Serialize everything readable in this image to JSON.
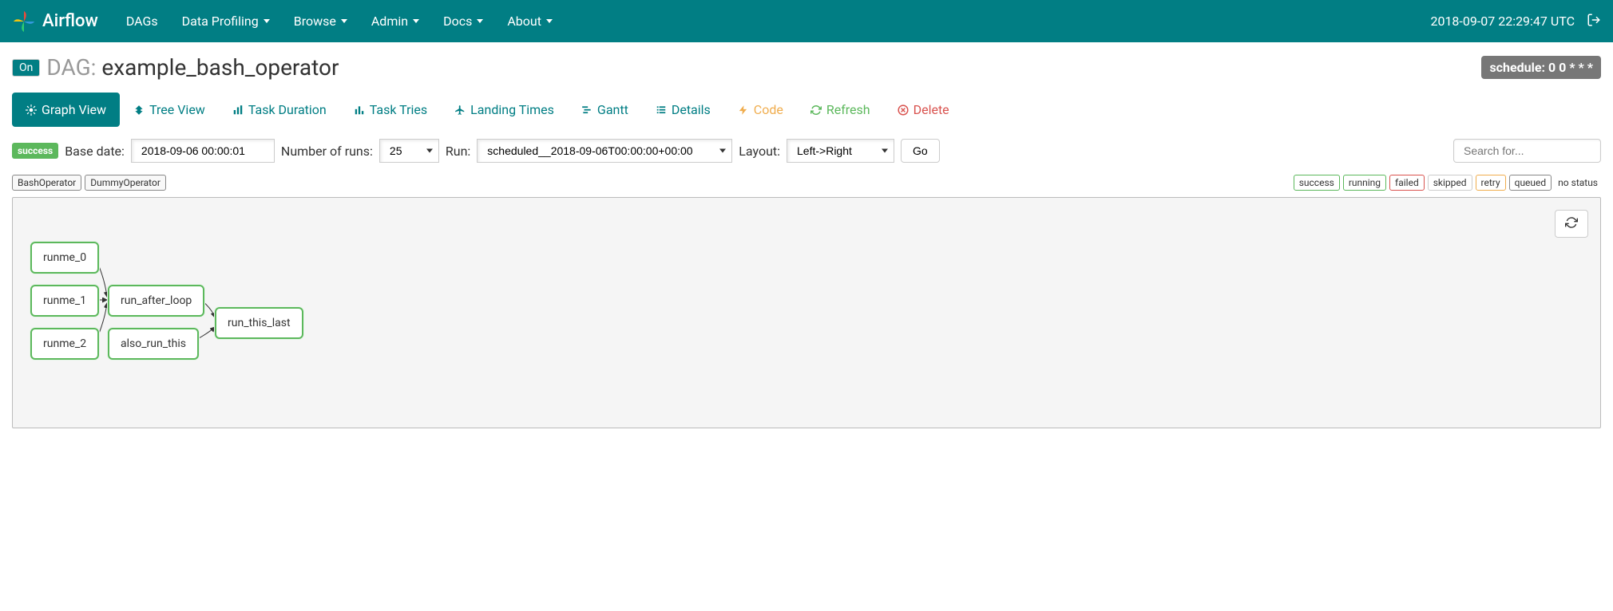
{
  "brand": "Airflow",
  "nav": {
    "items": [
      "DAGs",
      "Data Profiling",
      "Browse",
      "Admin",
      "Docs",
      "About"
    ],
    "clock": "2018-09-07 22:29:47 UTC"
  },
  "header": {
    "toggle": "On",
    "dag_label": "DAG:",
    "dag_name": "example_bash_operator",
    "schedule_label": "schedule: 0 0 * * *"
  },
  "tabs": [
    {
      "label": "Graph View"
    },
    {
      "label": "Tree View"
    },
    {
      "label": "Task Duration"
    },
    {
      "label": "Task Tries"
    },
    {
      "label": "Landing Times"
    },
    {
      "label": "Gantt"
    },
    {
      "label": "Details"
    },
    {
      "label": "Code"
    },
    {
      "label": "Refresh"
    },
    {
      "label": "Delete"
    }
  ],
  "filters": {
    "status_badge": "success",
    "base_date_label": "Base date:",
    "base_date_value": "2018-09-06 00:00:01",
    "num_runs_label": "Number of runs:",
    "num_runs_value": "25",
    "run_label": "Run:",
    "run_value": "scheduled__2018-09-06T00:00:00+00:00",
    "layout_label": "Layout:",
    "layout_value": "Left->Right",
    "go_label": "Go",
    "search_placeholder": "Search for..."
  },
  "operators": [
    "BashOperator",
    "DummyOperator"
  ],
  "statuses": [
    "success",
    "running",
    "failed",
    "skipped",
    "retry",
    "queued",
    "no status"
  ],
  "tasks": {
    "runme_0": "runme_0",
    "runme_1": "runme_1",
    "runme_2": "runme_2",
    "run_after_loop": "run_after_loop",
    "also_run_this": "also_run_this",
    "run_this_last": "run_this_last"
  }
}
